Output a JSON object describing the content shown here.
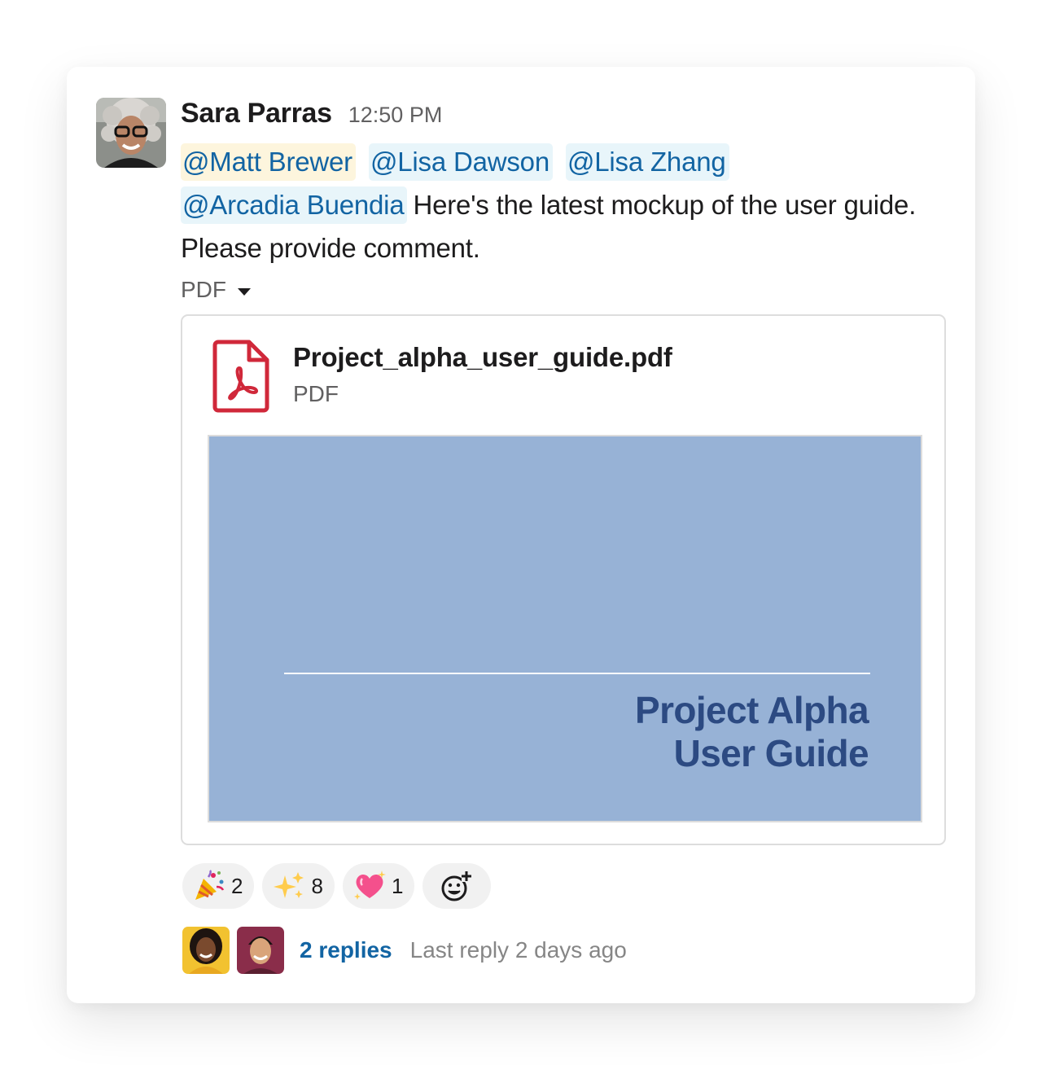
{
  "message": {
    "sender": "Sara Parras",
    "timestamp": "12:50 PM",
    "mentions": [
      {
        "text": "@Matt Brewer",
        "highlight": "self"
      },
      {
        "text": "@Lisa Dawson",
        "highlight": "other"
      },
      {
        "text": "@Lisa Zhang",
        "highlight": "other"
      },
      {
        "text": "@Arcadia Buendia",
        "highlight": "other"
      }
    ],
    "body": "Here's the latest mockup of the user guide. Please provide comment.",
    "attachment_toggle": "PDF"
  },
  "attachment": {
    "file_name": "Project_alpha_user_guide.pdf",
    "file_type": "PDF",
    "icon": "pdf-file-icon",
    "preview_title_line1": "Project Alpha",
    "preview_title_line2": "User Guide"
  },
  "reactions": [
    {
      "emoji": "party-popper",
      "count": "2"
    },
    {
      "emoji": "sparkles",
      "count": "8"
    },
    {
      "emoji": "sparkling-heart",
      "count": "1"
    }
  ],
  "thread": {
    "replies_label": "2 replies",
    "last_reply": "Last reply 2 days ago"
  },
  "colors": {
    "mention_text": "#1264a3",
    "mention_bg": "#e8f5fa",
    "mention_self_bg": "#fdf5dd",
    "preview_bg": "#97b2d6",
    "preview_title": "#2c4a82",
    "pdf_icon": "#d0283a"
  }
}
